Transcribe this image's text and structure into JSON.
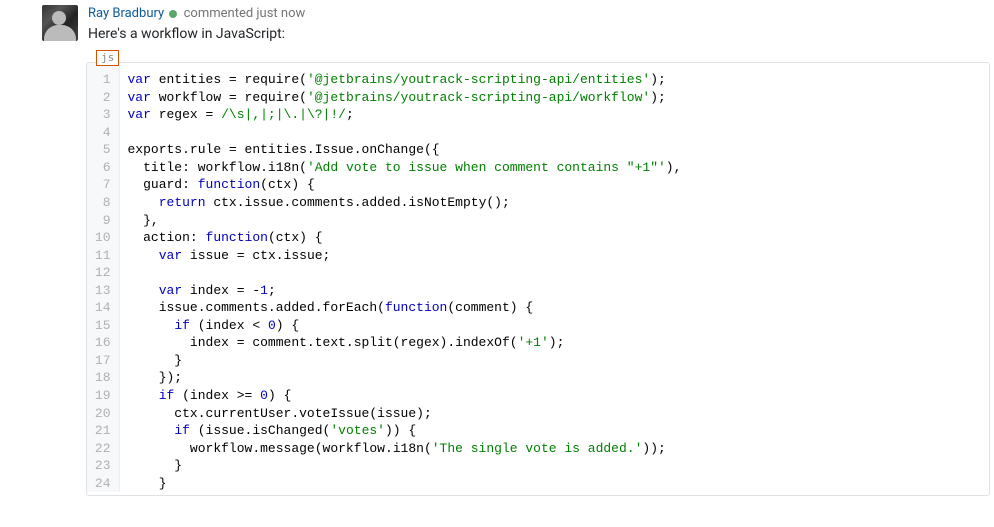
{
  "comment": {
    "author": "Ray Bradbury",
    "meta_text": "commented just now",
    "body": "Here's a workflow in JavaScript:"
  },
  "code": {
    "lang_label": "js",
    "lines": [
      [
        {
          "c": "tk-kw",
          "t": "var"
        },
        {
          "t": " entities = require("
        },
        {
          "c": "tk-str",
          "t": "'@jetbrains/youtrack-scripting-api/entities'"
        },
        {
          "t": ");"
        }
      ],
      [
        {
          "c": "tk-kw",
          "t": "var"
        },
        {
          "t": " workflow = require("
        },
        {
          "c": "tk-str",
          "t": "'@jetbrains/youtrack-scripting-api/workflow'"
        },
        {
          "t": ");"
        }
      ],
      [
        {
          "c": "tk-kw",
          "t": "var"
        },
        {
          "t": " regex = "
        },
        {
          "c": "tk-rx",
          "t": "/\\s|,|;|\\.|\\?|!/"
        },
        {
          "t": ";"
        }
      ],
      [
        {
          "t": ""
        }
      ],
      [
        {
          "t": "exports.rule = entities.Issue.onChange({"
        }
      ],
      [
        {
          "t": "  title: workflow.i18n("
        },
        {
          "c": "tk-str",
          "t": "'Add vote to issue when comment contains \"+1\"'"
        },
        {
          "t": "),"
        }
      ],
      [
        {
          "t": "  guard: "
        },
        {
          "c": "tk-kw",
          "t": "function"
        },
        {
          "t": "(ctx) {"
        }
      ],
      [
        {
          "t": "    "
        },
        {
          "c": "tk-kw",
          "t": "return"
        },
        {
          "t": " ctx.issue.comments.added.isNotEmpty();"
        }
      ],
      [
        {
          "t": "  },"
        }
      ],
      [
        {
          "t": "  action: "
        },
        {
          "c": "tk-kw",
          "t": "function"
        },
        {
          "t": "(ctx) {"
        }
      ],
      [
        {
          "t": "    "
        },
        {
          "c": "tk-kw",
          "t": "var"
        },
        {
          "t": " issue = ctx.issue;"
        }
      ],
      [
        {
          "t": ""
        }
      ],
      [
        {
          "t": "    "
        },
        {
          "c": "tk-kw",
          "t": "var"
        },
        {
          "t": " index = -"
        },
        {
          "c": "tk-num",
          "t": "1"
        },
        {
          "t": ";"
        }
      ],
      [
        {
          "t": "    issue.comments.added.forEach("
        },
        {
          "c": "tk-kw",
          "t": "function"
        },
        {
          "t": "(comment) {"
        }
      ],
      [
        {
          "t": "      "
        },
        {
          "c": "tk-kw",
          "t": "if"
        },
        {
          "t": " (index < "
        },
        {
          "c": "tk-num",
          "t": "0"
        },
        {
          "t": ") {"
        }
      ],
      [
        {
          "t": "        index = comment.text.split(regex).indexOf("
        },
        {
          "c": "tk-str",
          "t": "'+1'"
        },
        {
          "t": ");"
        }
      ],
      [
        {
          "t": "      }"
        }
      ],
      [
        {
          "t": "    });"
        }
      ],
      [
        {
          "t": "    "
        },
        {
          "c": "tk-kw",
          "t": "if"
        },
        {
          "t": " (index >= "
        },
        {
          "c": "tk-num",
          "t": "0"
        },
        {
          "t": ") {"
        }
      ],
      [
        {
          "t": "      ctx.currentUser.voteIssue(issue);"
        }
      ],
      [
        {
          "t": "      "
        },
        {
          "c": "tk-kw",
          "t": "if"
        },
        {
          "t": " (issue.isChanged("
        },
        {
          "c": "tk-str",
          "t": "'votes'"
        },
        {
          "t": ")) {"
        }
      ],
      [
        {
          "t": "        workflow.message(workflow.i18n("
        },
        {
          "c": "tk-str",
          "t": "'The single vote is added.'"
        },
        {
          "t": "));"
        }
      ],
      [
        {
          "t": "      }"
        }
      ],
      [
        {
          "t": "    }"
        }
      ]
    ]
  }
}
